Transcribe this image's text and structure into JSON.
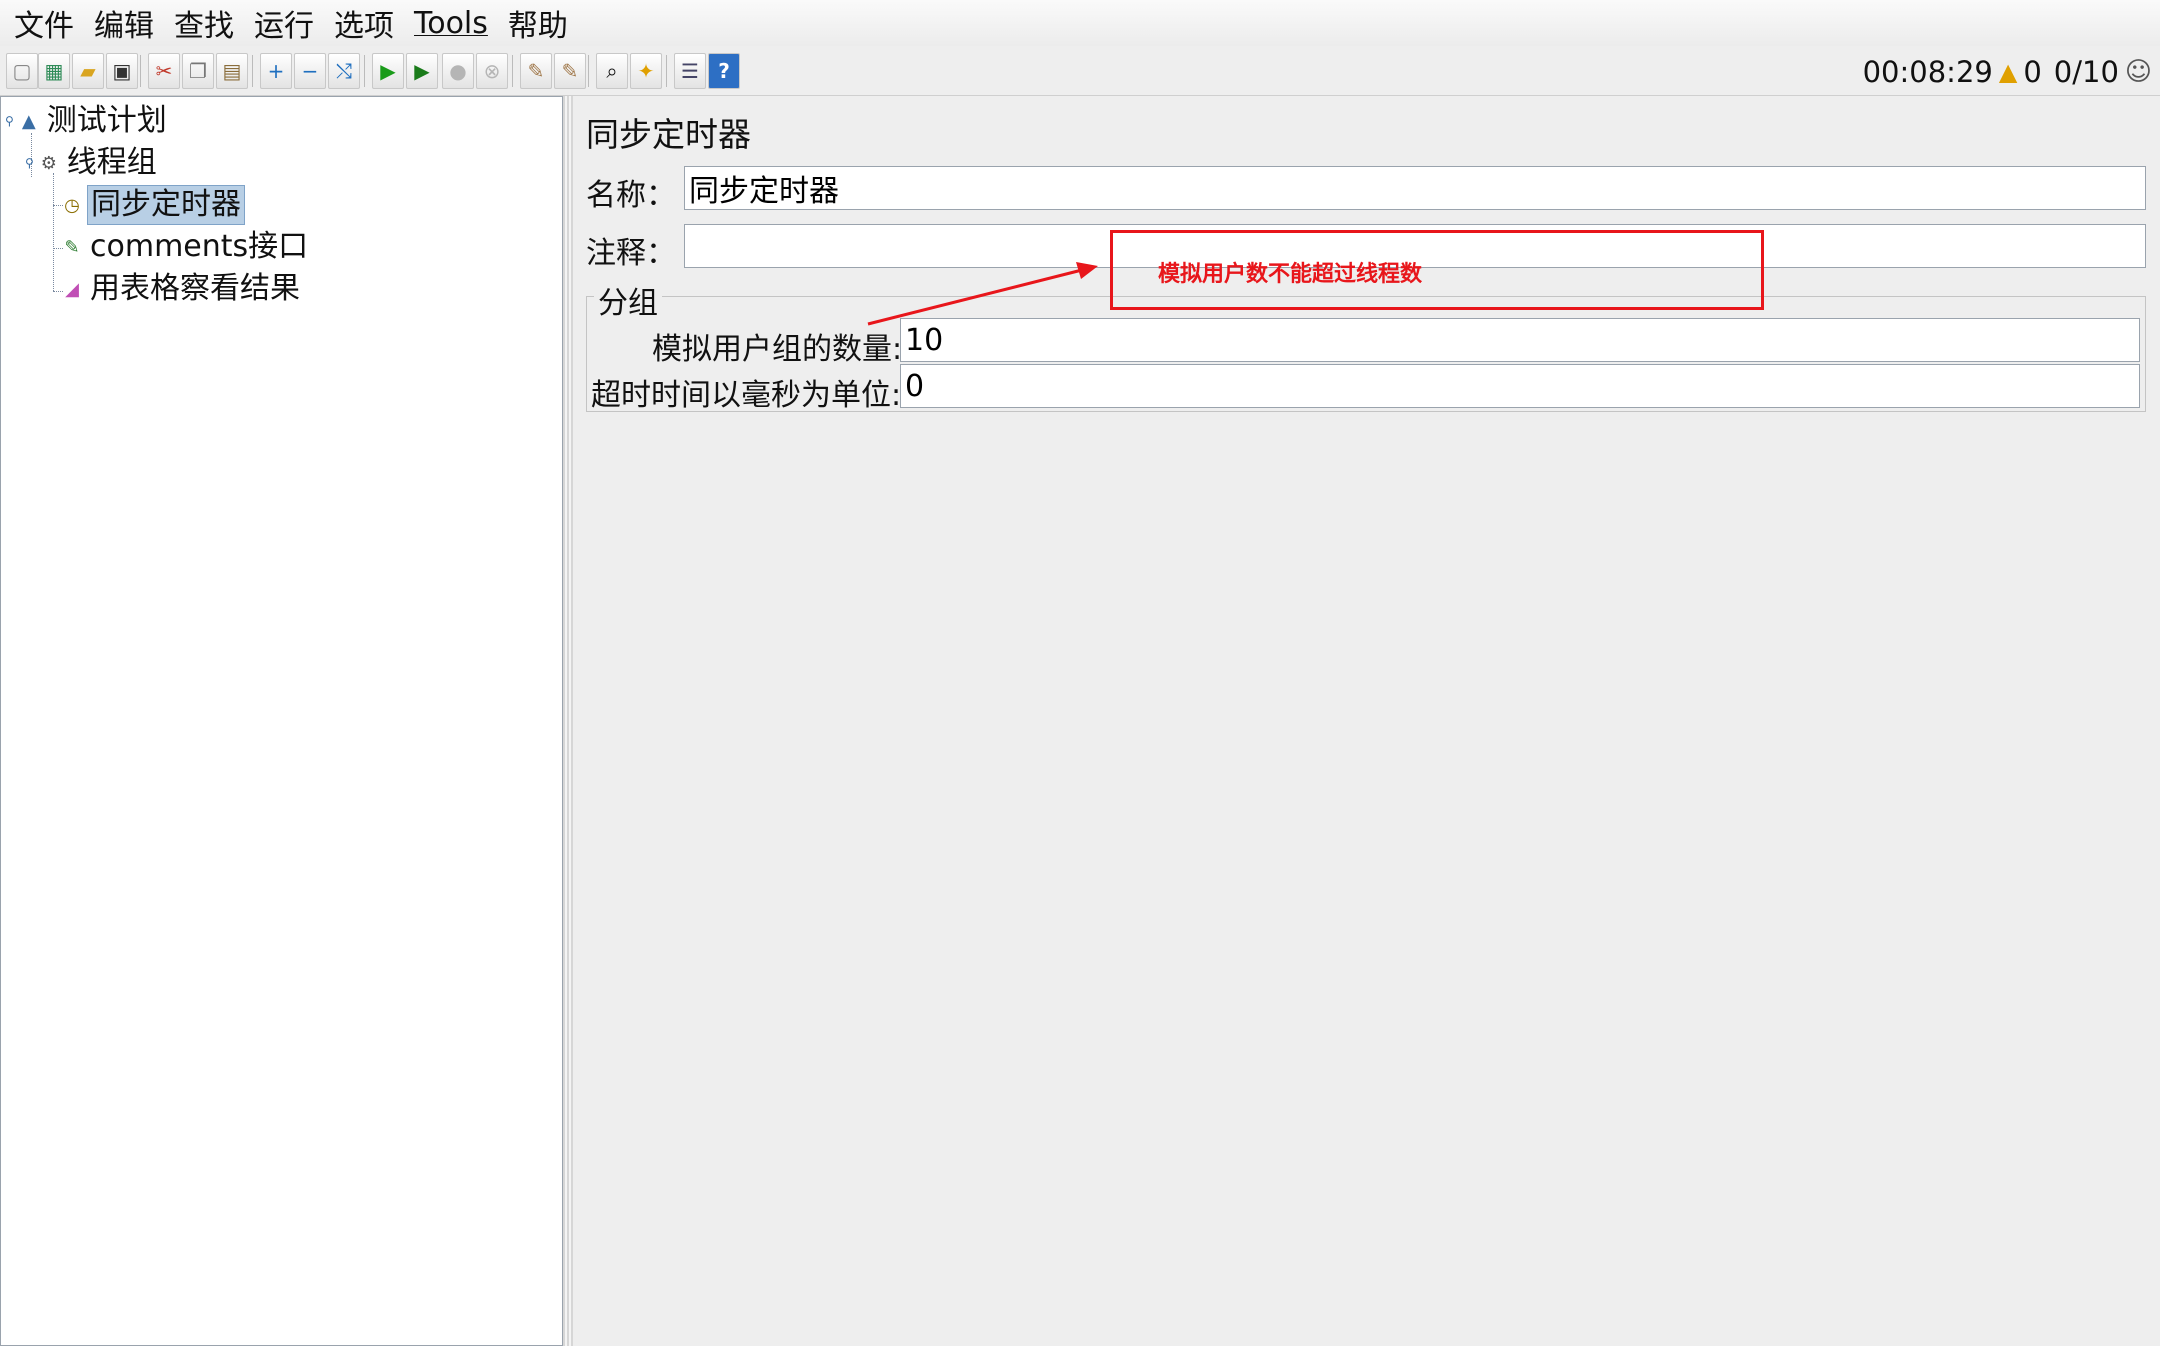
{
  "menu": [
    "文件",
    "编辑",
    "查找",
    "运行",
    "选项",
    "Tools",
    "帮助"
  ],
  "toolbar": {
    "buttons": [
      {
        "name": "new-icon",
        "glyph": "▢",
        "color": "#888"
      },
      {
        "name": "templates-icon",
        "glyph": "▦",
        "color": "#2e8b57"
      },
      {
        "name": "open-icon",
        "glyph": "▰",
        "color": "#d9a520"
      },
      {
        "name": "save-icon",
        "glyph": "▣",
        "color": "#333"
      },
      {
        "name": "cut-icon",
        "glyph": "✂",
        "color": "#c0392b"
      },
      {
        "name": "copy-icon",
        "glyph": "❐",
        "color": "#777"
      },
      {
        "name": "paste-icon",
        "glyph": "▤",
        "color": "#8a6d3b"
      },
      {
        "name": "expand-icon",
        "glyph": "+",
        "color": "#1f6fbf"
      },
      {
        "name": "collapse-icon",
        "glyph": "−",
        "color": "#1f6fbf"
      },
      {
        "name": "toggle-icon",
        "glyph": "⤭",
        "color": "#1f6fbf"
      },
      {
        "name": "start-icon",
        "glyph": "▶",
        "color": "#1a9b1a"
      },
      {
        "name": "start-no-pause-icon",
        "glyph": "▶",
        "color": "#1a7b1a"
      },
      {
        "name": "stop-icon",
        "glyph": "●",
        "color": "#b5b5b5"
      },
      {
        "name": "shutdown-icon",
        "glyph": "⊗",
        "color": "#b5b5b5"
      },
      {
        "name": "clear-icon",
        "glyph": "✎",
        "color": "#a0784a"
      },
      {
        "name": "clear-all-icon",
        "glyph": "✎",
        "color": "#a0784a"
      },
      {
        "name": "search-icon",
        "glyph": "⌕",
        "color": "#111"
      },
      {
        "name": "reset-search-icon",
        "glyph": "✦",
        "color": "#e0a000"
      },
      {
        "name": "function-helper-icon",
        "glyph": "☰",
        "color": "#446"
      },
      {
        "name": "help-icon",
        "glyph": "?",
        "color": "#ffffff"
      }
    ]
  },
  "status": {
    "elapsed": "00:08:29",
    "warnings": "0",
    "threads": "0/10"
  },
  "tree": {
    "test_plan": "测试计划",
    "thread_group": "线程组",
    "sync_timer": "同步定时器",
    "http_sampler": "comments接口",
    "results_table": "用表格察看结果"
  },
  "panel": {
    "title": "同步定时器",
    "name_label": "名称：",
    "name_value": "同步定时器",
    "comment_label": "注释：",
    "comment_value": "",
    "group_title": "分组",
    "users_label": "模拟用户组的数量:",
    "users_value": "10",
    "timeout_label": "超时时间以毫秒为单位:",
    "timeout_value": "0"
  },
  "annotation": {
    "text": "模拟用户数不能超过线程数",
    "color": "#e8161b"
  }
}
